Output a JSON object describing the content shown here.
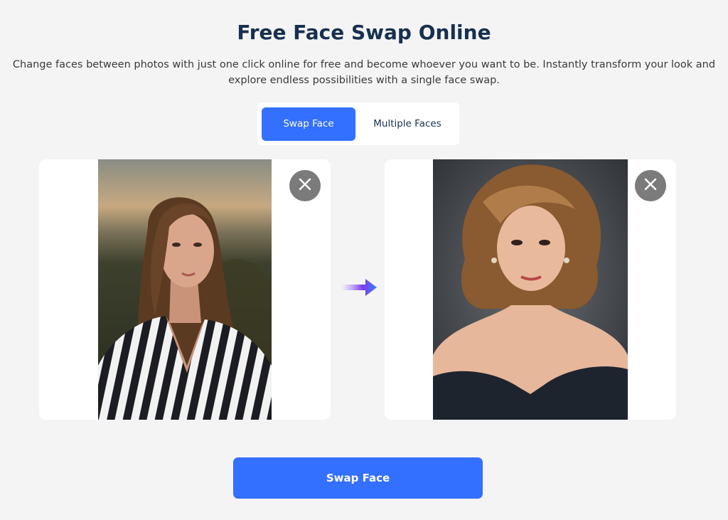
{
  "header": {
    "title": "Free Face Swap Online",
    "subtitle": "Change faces between photos with just one click online for free and become whoever you want to be. Instantly transform your look and explore endless possibilities with a single face swap."
  },
  "tabs": [
    {
      "label": "Swap Face",
      "active": true
    },
    {
      "label": "Multiple Faces",
      "active": false
    }
  ],
  "source_image": {
    "remove_icon": "close-icon"
  },
  "target_image": {
    "remove_icon": "close-icon"
  },
  "arrow_icon": "arrow-right-icon",
  "actions": {
    "swap_label": "Swap Face"
  },
  "colors": {
    "accent": "#3370ff",
    "title": "#17304f",
    "background": "#f4f4f5"
  }
}
